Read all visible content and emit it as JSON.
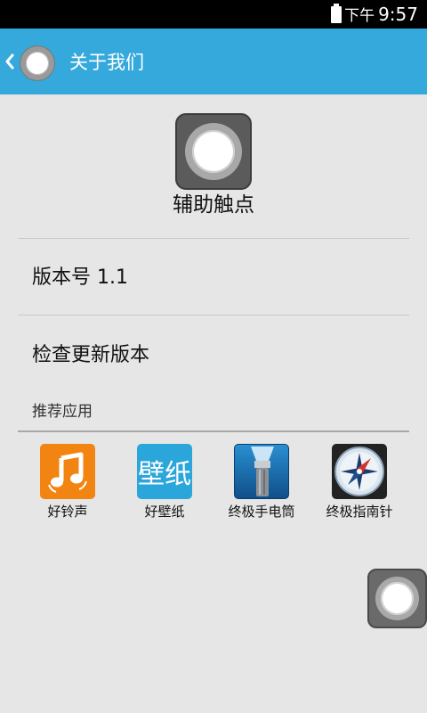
{
  "status_bar": {
    "ampm": "下午",
    "time": "9:57",
    "icons": [
      "battery-icon"
    ]
  },
  "action_bar": {
    "title": "关于我们",
    "back_icon": "chevron-left-icon",
    "app_icon": "assistive-touch-icon",
    "background": "#35a9dc"
  },
  "app": {
    "icon": "assistive-touch-icon",
    "name": "辅助触点"
  },
  "menu": {
    "version": "版本号 1.1",
    "check_update": "检查更新版本"
  },
  "recommended": {
    "title": "推荐应用",
    "apps": [
      {
        "label": "好铃声",
        "icon": "music-note-icon",
        "color": "#f28412"
      },
      {
        "label": "好壁纸",
        "icon": "wallpaper-app-icon",
        "color": "#2aa6db",
        "glyph": "壁纸"
      },
      {
        "label": "终极手电筒",
        "icon": "flashlight-icon",
        "color": "#1d6fb5"
      },
      {
        "label": "终极指南针",
        "icon": "compass-icon",
        "color": "#222222"
      }
    ]
  },
  "floating_button": {
    "icon": "assistive-touch-icon"
  }
}
